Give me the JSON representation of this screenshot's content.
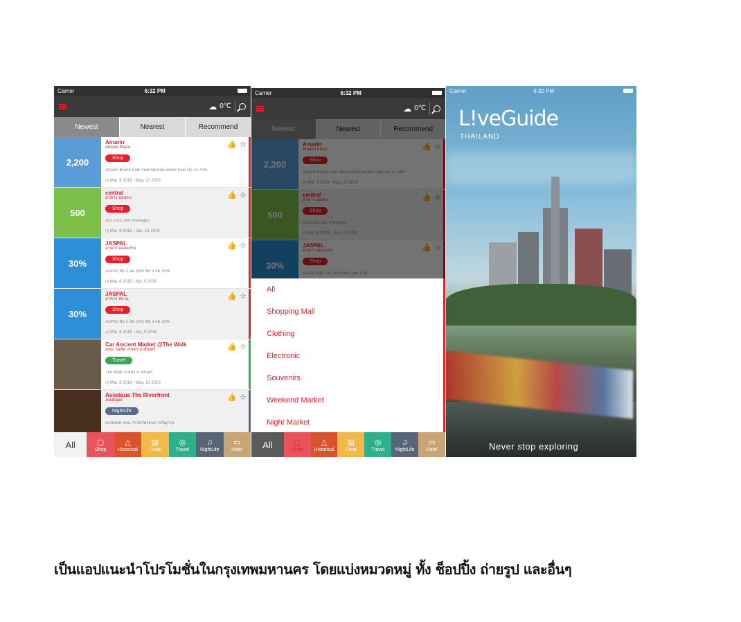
{
  "status": {
    "carrier": "Carrier",
    "time": "6:32 PM"
  },
  "weather": {
    "temp": "0℃"
  },
  "tabs": [
    "Newest",
    "Nearest",
    "Recommend"
  ],
  "items": [
    {
      "title": "Amarin",
      "subtitle": "Amarin Plaza",
      "badge": "Shop",
      "badge_color": "#e3202c",
      "desc": "Amarin Brand Sale International Brand Sale Up To 70%",
      "date": "Mar, 8 2016 - May, 27 2016",
      "thumb_text": "2,200",
      "thumb_color": "#5a9dd6"
    },
    {
      "title": "central",
      "subtitle": "อาคาร ออลแบ",
      "badge": "Shop",
      "badge_color": "#e3202c",
      "desc": "AIS LIVE 360 Privileges",
      "date": "Mar, 8 2016 - Jun, 15 2016",
      "thumb_text": "500",
      "thumb_color": "#7cc04a"
    },
    {
      "title": "JASPAL",
      "subtitle": "อาคาร ออลแทร่ว",
      "badge": "Shop",
      "badge_color": "#e3202c",
      "desc": "ASPAL ซื้อ 2 ลด 20% ซื้อ 3 ลด 30%",
      "date": "Mar, 8 2016 - Apr, 9 2016",
      "thumb_text": "30%",
      "thumb_color": "#2e8fd6"
    },
    {
      "title": "JASPAL",
      "subtitle": "อาคาร สยาม",
      "badge": "Shop",
      "badge_color": "#e3202c",
      "desc": "ASPAL ซื้อ 2 ลด 20% ซื้อ 3 ลด 30%",
      "date": "Mar, 8 2016 - Apr, 9 2016",
      "thumb_text": "30%",
      "thumb_color": "#2e8fd6"
    },
    {
      "title": "Car Ancient Market @The Walk",
      "subtitle": "เดอะ วอล์ค เกษตร-นวมินทร์",
      "badge": "Travel",
      "badge_color": "#3aa45a",
      "desc": "The Walk เกษตร-นวมินทร์",
      "date": "Mar, 8 2016 - May, 13 2016",
      "thumb_text": "",
      "thumb_color": "#6a5a4a"
    },
    {
      "title": "Asiatique The Riverfront",
      "subtitle": "Asiatique",
      "badge": "NightLife",
      "badge_color": "#5a6a8a",
      "desc": "เอเชียทีค เดอะ ริเวอร์ฟร้อนท์ เจริญกรุง",
      "date": "",
      "thumb_text": "",
      "thumb_color": "#4a3020"
    }
  ],
  "categories": [
    {
      "label": "All",
      "icon": "all",
      "color": "#f2f2f2"
    },
    {
      "label": "Shop",
      "icon": "shopping-bag",
      "color": "#e8545a"
    },
    {
      "label": "Historical",
      "icon": "temple",
      "color": "#d9542c"
    },
    {
      "label": "Food",
      "icon": "food",
      "color": "#f2b84a"
    },
    {
      "label": "Travel",
      "icon": "camera",
      "color": "#2eb08a"
    },
    {
      "label": "NightLife",
      "icon": "nightlife",
      "color": "#5a6478"
    },
    {
      "label": "Hotel",
      "icon": "bed",
      "color": "#c8a476"
    }
  ],
  "dropdown": [
    "All",
    "Shopping Mall",
    "Clothing",
    "Electronic",
    "Souvenirs",
    "Weekend Market",
    "Night Market"
  ],
  "splash": {
    "logo": "L!veGuide",
    "logo_sub": "THAILAND",
    "tagline": "Never stop exploring"
  },
  "caption": "เป็นแอปแนะนำโปรโมชั่นในกรุงเทพมหานคร โดยแบ่งหมวดหมู่ ทั้ง ช็อปปิ้ง ถ่ายรูป และอื่นๆ"
}
